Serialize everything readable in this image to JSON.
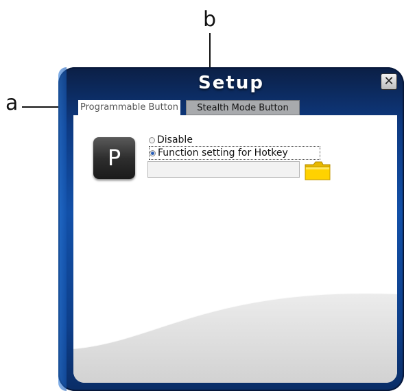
{
  "callouts": {
    "a": "a",
    "b": "b"
  },
  "window": {
    "title": "Setup",
    "close_icon": "close-icon"
  },
  "tabs": [
    {
      "label": "Programmable Button",
      "active": true
    },
    {
      "label": "Stealth Mode Button",
      "active": false
    }
  ],
  "programmable": {
    "key_letter": "P",
    "options": [
      {
        "label": "Disable",
        "checked": false
      },
      {
        "label": "Function setting for Hotkey",
        "checked": true
      }
    ],
    "hotkey_value": "",
    "browse_icon": "folder-icon"
  },
  "colors": {
    "frame": "#0e3f8a",
    "tab_inactive": "#a8aaad",
    "folder": "#ffd200"
  }
}
